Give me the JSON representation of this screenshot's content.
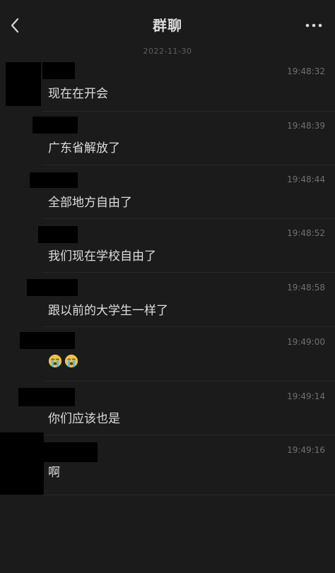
{
  "header": {
    "title": "群聊",
    "back_icon": "chevron-left-icon",
    "more_icon": "more-dots-icon"
  },
  "date_separator": "2022-11-30",
  "messages": [
    {
      "time": "19:48:32",
      "text": "现在在开会"
    },
    {
      "time": "19:48:39",
      "text": "广东省解放了"
    },
    {
      "time": "19:48:44",
      "text": "全部地方自由了"
    },
    {
      "time": "19:48:52",
      "text": "我们现在学校自由了"
    },
    {
      "time": "19:48:58",
      "text": "跟以前的大学生一样了"
    },
    {
      "time": "19:49:00",
      "text": "",
      "emojis": [
        "crying-face-emoji",
        "crying-face-emoji"
      ]
    },
    {
      "time": "19:49:14",
      "text": "你们应该也是"
    },
    {
      "time": "19:49:16",
      "text": "啊"
    }
  ]
}
